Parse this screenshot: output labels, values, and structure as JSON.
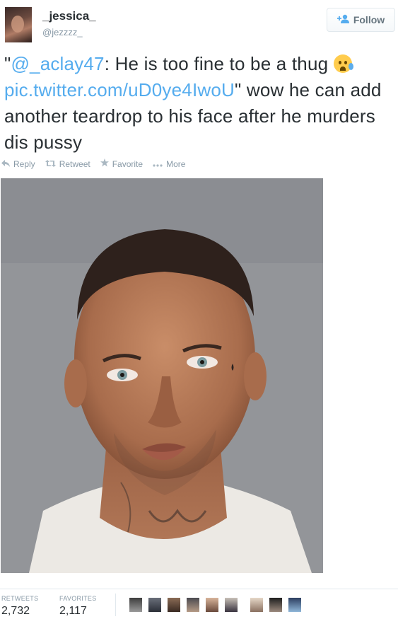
{
  "user": {
    "name": "_jessica_",
    "handle": "@jezzzz_"
  },
  "follow_button": {
    "label": "Follow"
  },
  "tweet": {
    "quote_open": "\"",
    "mention": "@_aclay47",
    "text_1": ": He is too fine to be a thug ",
    "emoji": "crying-face",
    "pic_link": "pic.twitter.com/uD0ye4IwoU",
    "text_2": "\" wow he can add another teardrop to his face after he murders dis pussy"
  },
  "actions": {
    "reply": "Reply",
    "retweet": "Retweet",
    "favorite": "Favorite",
    "more": "More"
  },
  "stats": {
    "retweets_label": "RETWEETS",
    "retweets_value": "2,732",
    "favorites_label": "FAVORITES",
    "favorites_value": "2,117"
  },
  "colors": {
    "link": "#55acee",
    "text": "#292f33",
    "muted": "#8899a6"
  }
}
